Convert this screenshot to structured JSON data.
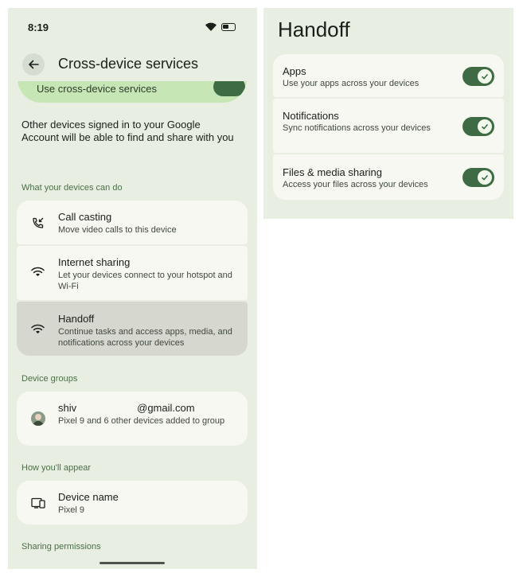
{
  "status": {
    "time": "8:19"
  },
  "left": {
    "title": "Cross-device services",
    "master_label": "Use cross-device services",
    "description": "Other devices signed in to your Google Account will be able to find and share with you",
    "section_can_do": "What your devices can do",
    "items": [
      {
        "title": "Call casting",
        "subtitle": "Move video calls to this device",
        "icon": "call-cast-icon"
      },
      {
        "title": "Internet sharing",
        "subtitle": "Let your devices connect to your hotspot and Wi-Fi",
        "icon": "wifi-icon"
      },
      {
        "title": "Handoff",
        "subtitle": "Continue tasks and access apps, media, and notifications across your devices",
        "icon": "wifi-icon"
      }
    ],
    "section_groups": "Device groups",
    "account": {
      "email_prefix": "shiv",
      "email_suffix": "@gmail.com",
      "subtitle": "Pixel 9 and 6 other devices added to group"
    },
    "section_appear": "How you'll appear",
    "device": {
      "title": "Device name",
      "value": "Pixel 9"
    },
    "section_permissions": "Sharing permissions"
  },
  "right": {
    "title": "Handoff",
    "toggles": [
      {
        "title": "Apps",
        "subtitle": "Use your apps across your devices",
        "on": true
      },
      {
        "title": "Notifications",
        "subtitle": "Sync notifications across your devices",
        "on": true
      },
      {
        "title": "Files & media sharing",
        "subtitle": "Access your files across your devices",
        "on": true
      }
    ]
  },
  "colors": {
    "background": "#e8efe2",
    "card": "#f6f8f1",
    "accent": "#3e6b44",
    "master_card": "#c7e6b5",
    "selected_card": "#d6d8d0",
    "section_text": "#4a6f47"
  }
}
